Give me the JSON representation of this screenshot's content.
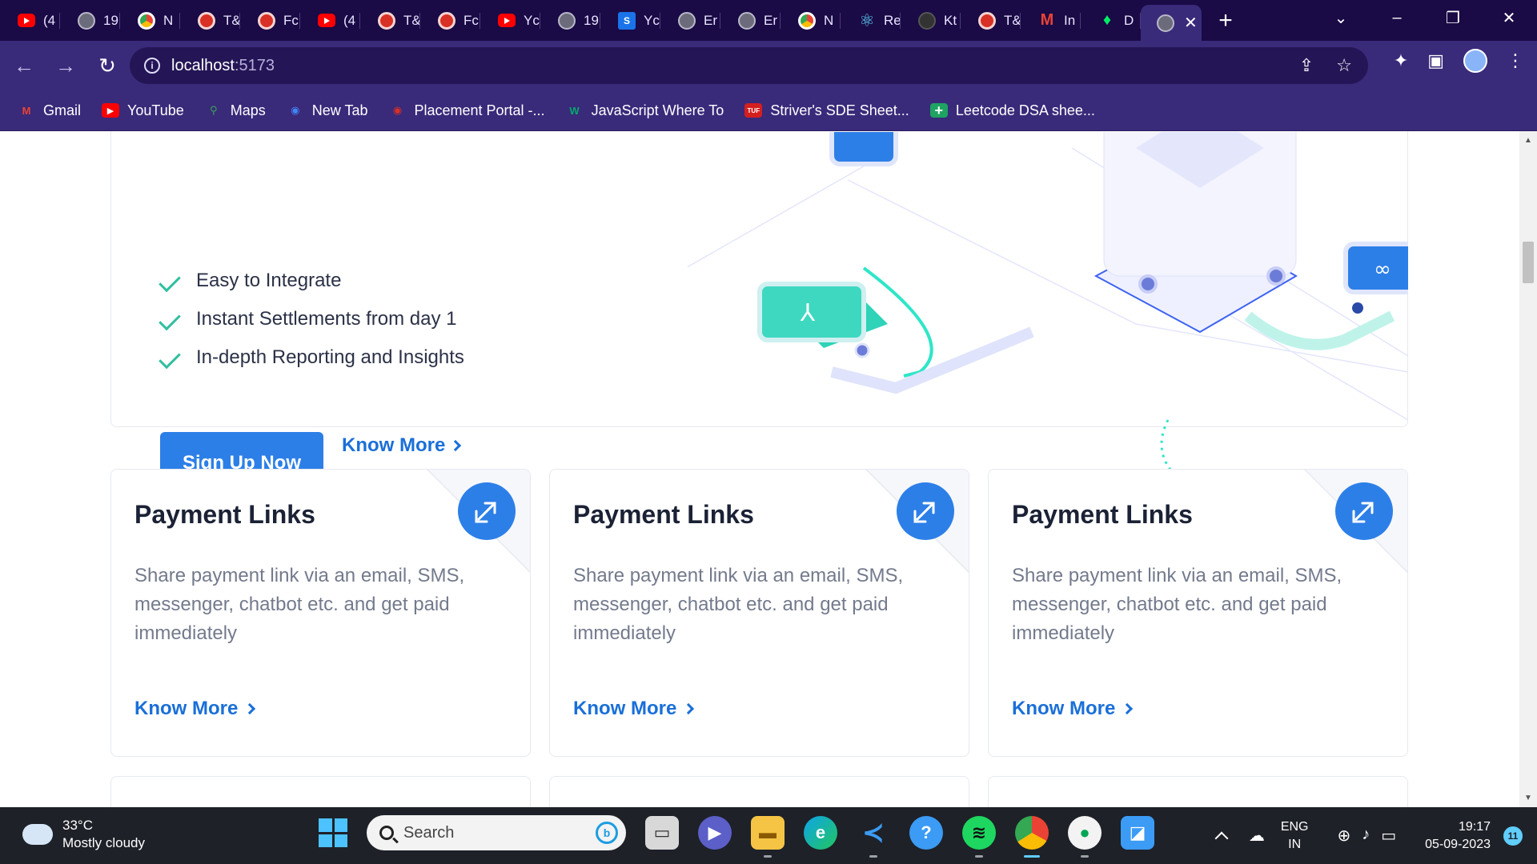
{
  "browser": {
    "tabs": [
      {
        "icon": "youtube-icon",
        "label": "(4"
      },
      {
        "icon": "globe-icon",
        "label": "19"
      },
      {
        "icon": "chrome-icon",
        "label": "N"
      },
      {
        "icon": "red-circle-icon",
        "label": "T&"
      },
      {
        "icon": "red-circle-icon",
        "label": "Fc"
      },
      {
        "icon": "youtube-icon",
        "label": "(4"
      },
      {
        "icon": "red-circle-icon",
        "label": "T&"
      },
      {
        "icon": "red-circle-icon",
        "label": "Fc"
      },
      {
        "icon": "youtube-icon",
        "label": "Yc"
      },
      {
        "icon": "globe-icon",
        "label": "19"
      },
      {
        "icon": "s-icon",
        "label": "Yc"
      },
      {
        "icon": "globe-icon",
        "label": "Er"
      },
      {
        "icon": "globe-icon",
        "label": "Er"
      },
      {
        "icon": "chrome-icon",
        "label": "N"
      },
      {
        "icon": "react-icon",
        "label": "Re"
      },
      {
        "icon": "github-icon",
        "label": "Kt"
      },
      {
        "icon": "red-circle-icon",
        "label": "T&"
      },
      {
        "icon": "gmail-icon",
        "label": "In"
      },
      {
        "icon": "mongodb-icon",
        "label": "D"
      }
    ],
    "active_tab_close": "✕",
    "new_tab": "+",
    "url_host": "localhost",
    "url_port": ":5173",
    "bookmarks": [
      {
        "icon": "gmail-icon",
        "label": "Gmail",
        "color": "#ea4335"
      },
      {
        "icon": "youtube-icon",
        "label": "YouTube",
        "color": "#ff0000"
      },
      {
        "icon": "maps-icon",
        "label": "Maps",
        "color": "#34a853"
      },
      {
        "icon": "chrome-icon",
        "label": "New Tab",
        "color": "#4285f4"
      },
      {
        "icon": "red-circle-icon",
        "label": "Placement Portal -...",
        "color": "#d93025"
      },
      {
        "icon": "w3schools-icon",
        "label": "JavaScript Where To",
        "color": "#04aa6d"
      },
      {
        "icon": "tuf-icon",
        "label": "Striver's SDE Sheet...",
        "color": "#d41f1f"
      },
      {
        "icon": "sheets-plus-icon",
        "label": "Leetcode DSA shee...",
        "color": "#1ea362"
      }
    ]
  },
  "hero": {
    "features": [
      "Easy to Integrate",
      "Instant Settlements from day 1",
      "In-depth Reporting and Insights"
    ],
    "signup_label": "Sign Up Now",
    "know_more_label": "Know More"
  },
  "cards": [
    {
      "title": "Payment Links",
      "description": "Share payment link via an email, SMS, messenger, chatbot etc. and get paid immediately",
      "link": "Know More"
    },
    {
      "title": "Payment Links",
      "description": "Share payment link via an email, SMS, messenger, chatbot etc. and get paid immediately",
      "link": "Know More"
    },
    {
      "title": "Payment Links",
      "description": "Share payment link via an email, SMS, messenger, chatbot etc. and get paid immediately",
      "link": "Know More"
    }
  ],
  "colors": {
    "brand_blue": "#2d7fe8",
    "link_blue": "#1a6fd8",
    "check_green": "#2fbf9f",
    "browser_purple": "#3a2a7a"
  },
  "taskbar": {
    "temperature": "33°C",
    "weather": "Mostly cloudy",
    "search_placeholder": "Search",
    "lang_top": "ENG",
    "lang_bottom": "IN",
    "time": "19:17",
    "date": "05-09-2023",
    "notifications": "11"
  }
}
